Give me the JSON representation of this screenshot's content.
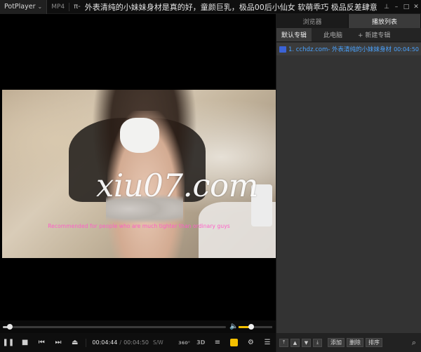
{
  "app": {
    "name": "PotPlayer",
    "format": "MP4",
    "pi": "π-",
    "title": "外表清纯的小妹妹身材是真的好，童颜巨乳，极品00后小仙女 软萌乖巧 极品反差肆意"
  },
  "video": {
    "caption": "Recommended for people who are much tighter than ordinary guys",
    "watermark": "xiu07.com"
  },
  "playback": {
    "current_time": "00:04:44",
    "total_time": "00:04:50",
    "sw_label": "S/W",
    "progress": 0.03,
    "volume": 0.38
  },
  "panel": {
    "tabs": [
      "浏览器",
      "播放列表"
    ],
    "active_tab": 1,
    "subtabs": [
      "默认专辑",
      "此电脑",
      "+ 新建专辑"
    ],
    "items": [
      {
        "name": "1. cchdz.com-    外表清纯的小妹妹身材...",
        "duration": "00:04:50"
      }
    ],
    "bottom_buttons": [
      "添加",
      "删除",
      "排序"
    ]
  },
  "icons": {
    "pause": "pause-icon",
    "stop": "stop-icon",
    "prev": "previous-icon",
    "next": "next-icon",
    "eject": "eject-icon"
  }
}
